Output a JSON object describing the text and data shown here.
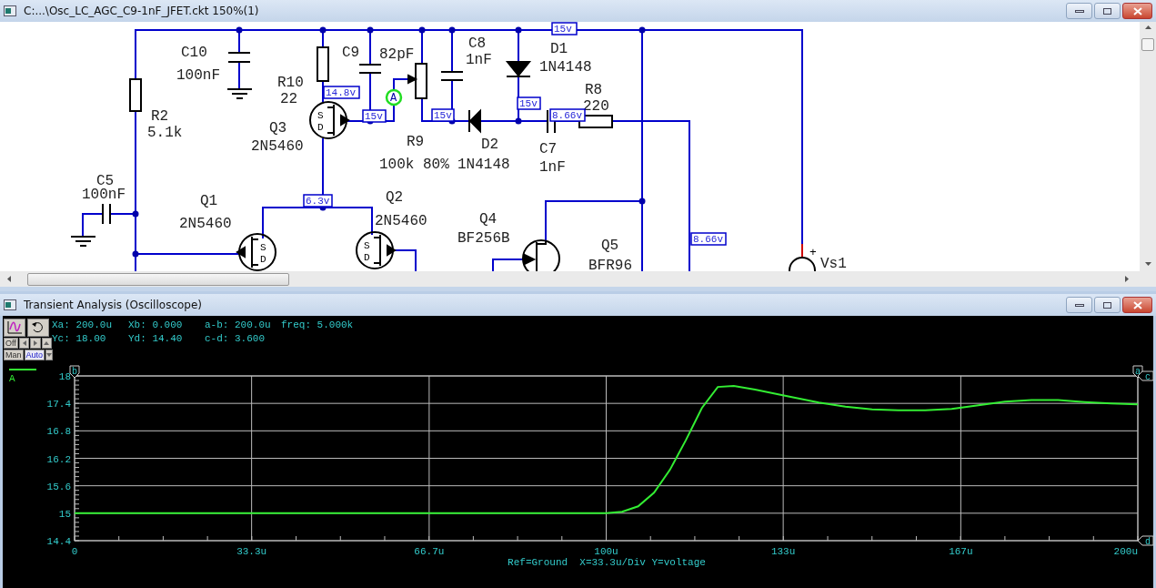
{
  "schematic_window": {
    "title": "C:...\\Osc_LC_AGC_C9-1nF_JFET.ckt 150%(1)"
  },
  "schematic": {
    "components": [
      {
        "name": "C10",
        "value": "100nF"
      },
      {
        "name": "R2",
        "value": "5.1k"
      },
      {
        "name": "C5",
        "value": "100nF"
      },
      {
        "name": "Q1",
        "value": "2N5460",
        "pins": [
          "S",
          "D"
        ]
      },
      {
        "name": "R10",
        "value": "22"
      },
      {
        "name": "Q3",
        "value": "2N5460",
        "pins": [
          "S",
          "D"
        ]
      },
      {
        "name": "C9",
        "value": "82pF"
      },
      {
        "name": "C8",
        "value": "1nF"
      },
      {
        "name": "D1",
        "value": "1N4148"
      },
      {
        "name": "R8",
        "value": "220"
      },
      {
        "name": "R9",
        "value": "100k 80%"
      },
      {
        "name": "D2",
        "value": "1N4148"
      },
      {
        "name": "C7",
        "value": "1nF"
      },
      {
        "name": "Q2",
        "value": "2N5460",
        "pins": [
          "S",
          "D"
        ]
      },
      {
        "name": "Q4",
        "value": "BF256B"
      },
      {
        "name": "Q5",
        "value": "BFR96"
      },
      {
        "name": "Vs1"
      }
    ],
    "node_voltages": [
      "15v",
      "14.8v",
      "15v",
      "15v",
      "15v",
      "8.66v",
      "6.3v",
      "8.66v"
    ],
    "probe": {
      "label": "A"
    },
    "source_polarity": "+"
  },
  "scope_window": {
    "title": "Transient Analysis (Oscilloscope)"
  },
  "scope": {
    "readouts": [
      [
        "Xa: 200.0u",
        "Xb: 0.000",
        "a-b: 200.0u",
        "freq: 5.000k"
      ],
      [
        "Yc: 18.00",
        "Yd: 14.40",
        "c-d: 3.600"
      ]
    ],
    "off_button": "Off",
    "modes": [
      {
        "label": "Man",
        "selected": false
      },
      {
        "label": "Auto",
        "selected": true
      }
    ],
    "cursor_markers": [
      "b",
      "a",
      "c",
      "d"
    ],
    "footer": "Ref=Ground  X=33.3u/Div Y=voltage",
    "chart_data": {
      "type": "line",
      "x": [
        0,
        20,
        40,
        60,
        80,
        95,
        100,
        103,
        106,
        109,
        112,
        115,
        118,
        121,
        124,
        128,
        133,
        140,
        145,
        150,
        155,
        160,
        165,
        170,
        175,
        180,
        185,
        190,
        195,
        200
      ],
      "series": [
        {
          "name": "A",
          "color": "#33ee33",
          "values": [
            15,
            15,
            15,
            15,
            15,
            15,
            15,
            15.03,
            15.15,
            15.45,
            15.95,
            16.6,
            17.3,
            17.76,
            17.78,
            17.7,
            17.58,
            17.42,
            17.33,
            17.27,
            17.25,
            17.25,
            17.28,
            17.36,
            17.44,
            17.47,
            17.47,
            17.43,
            17.4,
            17.38
          ]
        }
      ],
      "xlim": [
        0,
        200
      ],
      "ylim": [
        14.4,
        18
      ],
      "grid": true,
      "xticks": [
        {
          "value": 0,
          "label": "0"
        },
        {
          "value": 33.3,
          "label": "33.3u"
        },
        {
          "value": 66.7,
          "label": "66.7u"
        },
        {
          "value": 100,
          "label": "100u"
        },
        {
          "value": 133.3,
          "label": "133u"
        },
        {
          "value": 166.7,
          "label": "167u"
        },
        {
          "value": 200,
          "label": "200u"
        }
      ],
      "yticks": [
        14.4,
        15,
        15.6,
        16.2,
        16.8,
        17.4,
        18
      ]
    }
  }
}
